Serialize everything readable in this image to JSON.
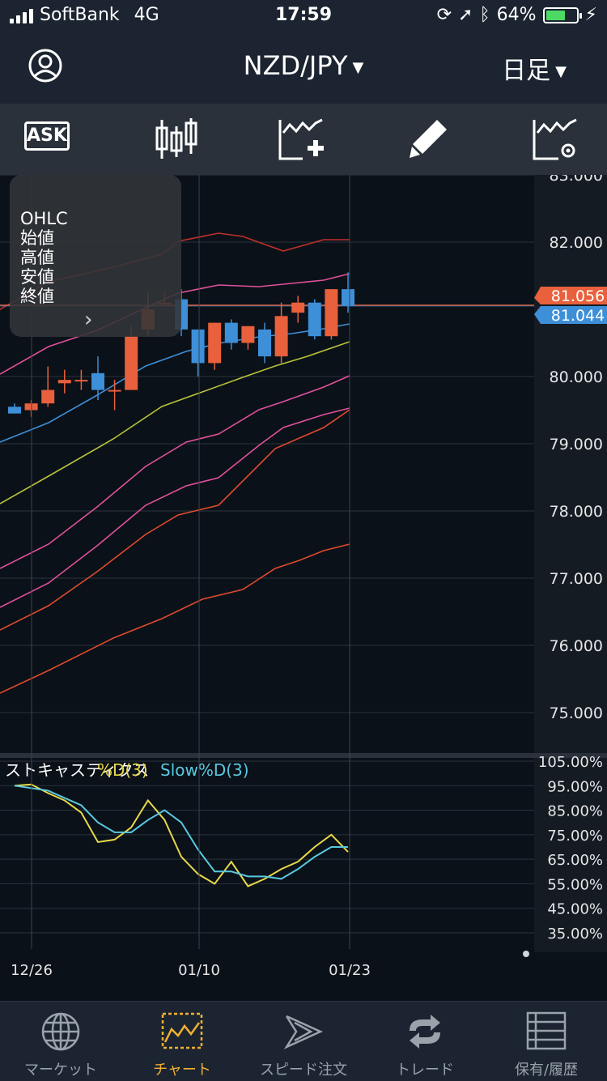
{
  "status_bar": {
    "carrier": "SoftBank",
    "network": "4G",
    "time": "17:59",
    "battery_text": "64%",
    "battery_level": 0.64
  },
  "header": {
    "pair": "NZD/JPY",
    "timeframe": "日足"
  },
  "toolbar": {
    "ask_label": "ASK",
    "icons": [
      "candlestick-icon",
      "add-indicator-icon",
      "pencil-icon",
      "indicator-settings-icon"
    ]
  },
  "ohlc_panel": {
    "title": "OHLC",
    "open_label": "始値",
    "high_label": "高値",
    "low_label": "安値",
    "close_label": "終値",
    "arrow": "›"
  },
  "price_axis": {
    "labels": [
      "83.000",
      "82.000",
      "81.056",
      "81.044",
      "80.000",
      "79.000",
      "78.000",
      "77.000",
      "76.000",
      "75.000"
    ],
    "bid": "81.056",
    "ask": "81.044"
  },
  "stochastic": {
    "title": "ストキャスティクス",
    "d_label": "%D(3)",
    "slow_label": "Slow%D(3)",
    "axis_labels": [
      "105.00%",
      "95.00%",
      "85.00%",
      "75.00%",
      "65.00%",
      "55.00%",
      "45.00%",
      "35.00%"
    ]
  },
  "date_axis": [
    "12/26",
    "01/10",
    "01/23"
  ],
  "tabs": [
    {
      "label": "マーケット",
      "icon": "globe-icon",
      "active": false
    },
    {
      "label": "チャート",
      "icon": "chart-icon",
      "active": true
    },
    {
      "label": "スピード注文",
      "icon": "speed-order-icon",
      "active": false
    },
    {
      "label": "トレード",
      "icon": "trade-icon",
      "active": false
    },
    {
      "label": "保有/履歴",
      "icon": "history-icon",
      "active": false
    }
  ],
  "colors": {
    "bull": "#e8603c",
    "bear": "#3d8fd8",
    "bid_bg": "#e8603c",
    "ask_bg": "#3d8fd8",
    "active_tab": "#f2b030",
    "stoch_d": "#e8d84a",
    "stoch_slow": "#59c8e0"
  },
  "chart_data": {
    "type": "candlestick",
    "y_range": [
      75.0,
      83.0
    ],
    "candles": [
      {
        "o": 79.55,
        "h": 79.6,
        "l": 79.45,
        "c": 79.45
      },
      {
        "o": 79.5,
        "h": 79.65,
        "l": 79.4,
        "c": 79.6
      },
      {
        "o": 79.6,
        "h": 80.15,
        "l": 79.55,
        "c": 79.8
      },
      {
        "o": 79.9,
        "h": 80.1,
        "l": 79.75,
        "c": 79.95
      },
      {
        "o": 79.95,
        "h": 80.1,
        "l": 79.8,
        "c": 79.95
      },
      {
        "o": 80.05,
        "h": 80.3,
        "l": 79.65,
        "c": 79.8
      },
      {
        "o": 79.8,
        "h": 79.95,
        "l": 79.5,
        "c": 79.8
      },
      {
        "o": 79.8,
        "h": 80.75,
        "l": 79.8,
        "c": 80.6
      },
      {
        "o": 80.7,
        "h": 81.25,
        "l": 80.6,
        "c": 81.0
      },
      {
        "o": 81.1,
        "h": 81.25,
        "l": 81.05,
        "c": 81.1
      },
      {
        "o": 81.15,
        "h": 81.3,
        "l": 80.6,
        "c": 80.7
      },
      {
        "o": 80.7,
        "h": 80.7,
        "l": 80.0,
        "c": 80.2
      },
      {
        "o": 80.2,
        "h": 80.8,
        "l": 80.1,
        "c": 80.8
      },
      {
        "o": 80.8,
        "h": 80.85,
        "l": 80.4,
        "c": 80.5
      },
      {
        "o": 80.5,
        "h": 80.75,
        "l": 80.4,
        "c": 80.75
      },
      {
        "o": 80.7,
        "h": 80.8,
        "l": 80.2,
        "c": 80.3
      },
      {
        "o": 80.3,
        "h": 81.1,
        "l": 80.2,
        "c": 80.9
      },
      {
        "o": 80.95,
        "h": 81.2,
        "l": 80.8,
        "c": 81.1
      },
      {
        "o": 81.1,
        "h": 81.15,
        "l": 80.55,
        "c": 80.6
      },
      {
        "o": 80.6,
        "h": 81.3,
        "l": 80.55,
        "c": 81.3
      },
      {
        "o": 81.3,
        "h": 81.55,
        "l": 80.95,
        "c": 81.05
      }
    ],
    "stoch_d": [
      95,
      95.5,
      92,
      89,
      84,
      72,
      73,
      78,
      89,
      81,
      66,
      59,
      55,
      64,
      54,
      57,
      61,
      64,
      70,
      75,
      68
    ],
    "stoch_slow": [
      95,
      94,
      93,
      90,
      87,
      80,
      76,
      76,
      81,
      85,
      80,
      69,
      60,
      60,
      58,
      58,
      57,
      61,
      66,
      70,
      70
    ]
  }
}
